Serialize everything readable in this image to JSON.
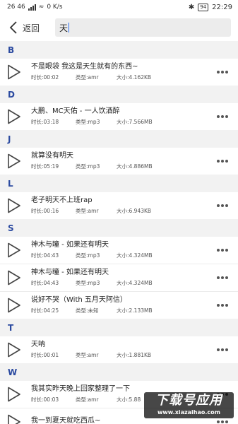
{
  "status_bar": {
    "left_text": "26 46",
    "speed": "0 K/s",
    "battery": "94",
    "time": "22:29"
  },
  "header": {
    "back_label": "返回",
    "search_value": "天"
  },
  "sections": [
    {
      "letter": "B",
      "items": [
        {
          "title": "不是眼袋 我这是天生就有的东西~",
          "duration": "时长:00:02",
          "type": "类型:amr",
          "size": "大小:4.162KB"
        }
      ]
    },
    {
      "letter": "D",
      "items": [
        {
          "title": "大鹏、MC天佑 - 一人饮酒醉",
          "duration": "时长:03:18",
          "type": "类型:mp3",
          "size": "大小:7.566MB"
        }
      ]
    },
    {
      "letter": "J",
      "items": [
        {
          "title": "就算没有明天",
          "duration": "时长:05:19",
          "type": "类型:mp3",
          "size": "大小:4.886MB"
        }
      ]
    },
    {
      "letter": "L",
      "items": [
        {
          "title": "老子明天不上班rap",
          "duration": "时长:00:16",
          "type": "类型:amr",
          "size": "大小:6.943KB"
        }
      ]
    },
    {
      "letter": "S",
      "items": [
        {
          "title": "神木与瞳 - 如果还有明天",
          "duration": "时长:04:43",
          "type": "类型:mp3",
          "size": "大小:4.324MB"
        },
        {
          "title": "神木与瞳 - 如果还有明天",
          "duration": "时长:04:43",
          "type": "类型:mp3",
          "size": "大小:4.324MB"
        },
        {
          "title": "说好不哭（With 五月天阿信）",
          "duration": "时长:04:25",
          "type": "类型:未知",
          "size": "大小:2.133MB"
        }
      ]
    },
    {
      "letter": "T",
      "items": [
        {
          "title": "天呐",
          "duration": "时长:00:01",
          "type": "类型:amr",
          "size": "大小:1.881KB"
        }
      ]
    },
    {
      "letter": "W",
      "items": [
        {
          "title": "我其实昨天晚上回家整理了一下",
          "duration": "时长:00:03",
          "type": "类型:amr",
          "size": "大小:5.88"
        },
        {
          "title": "我一到夏天就吃西瓜~",
          "duration": "",
          "type": "",
          "size": ""
        }
      ]
    }
  ],
  "watermark": {
    "title": "下载号应用",
    "url": "www.xiazaihao.com"
  }
}
